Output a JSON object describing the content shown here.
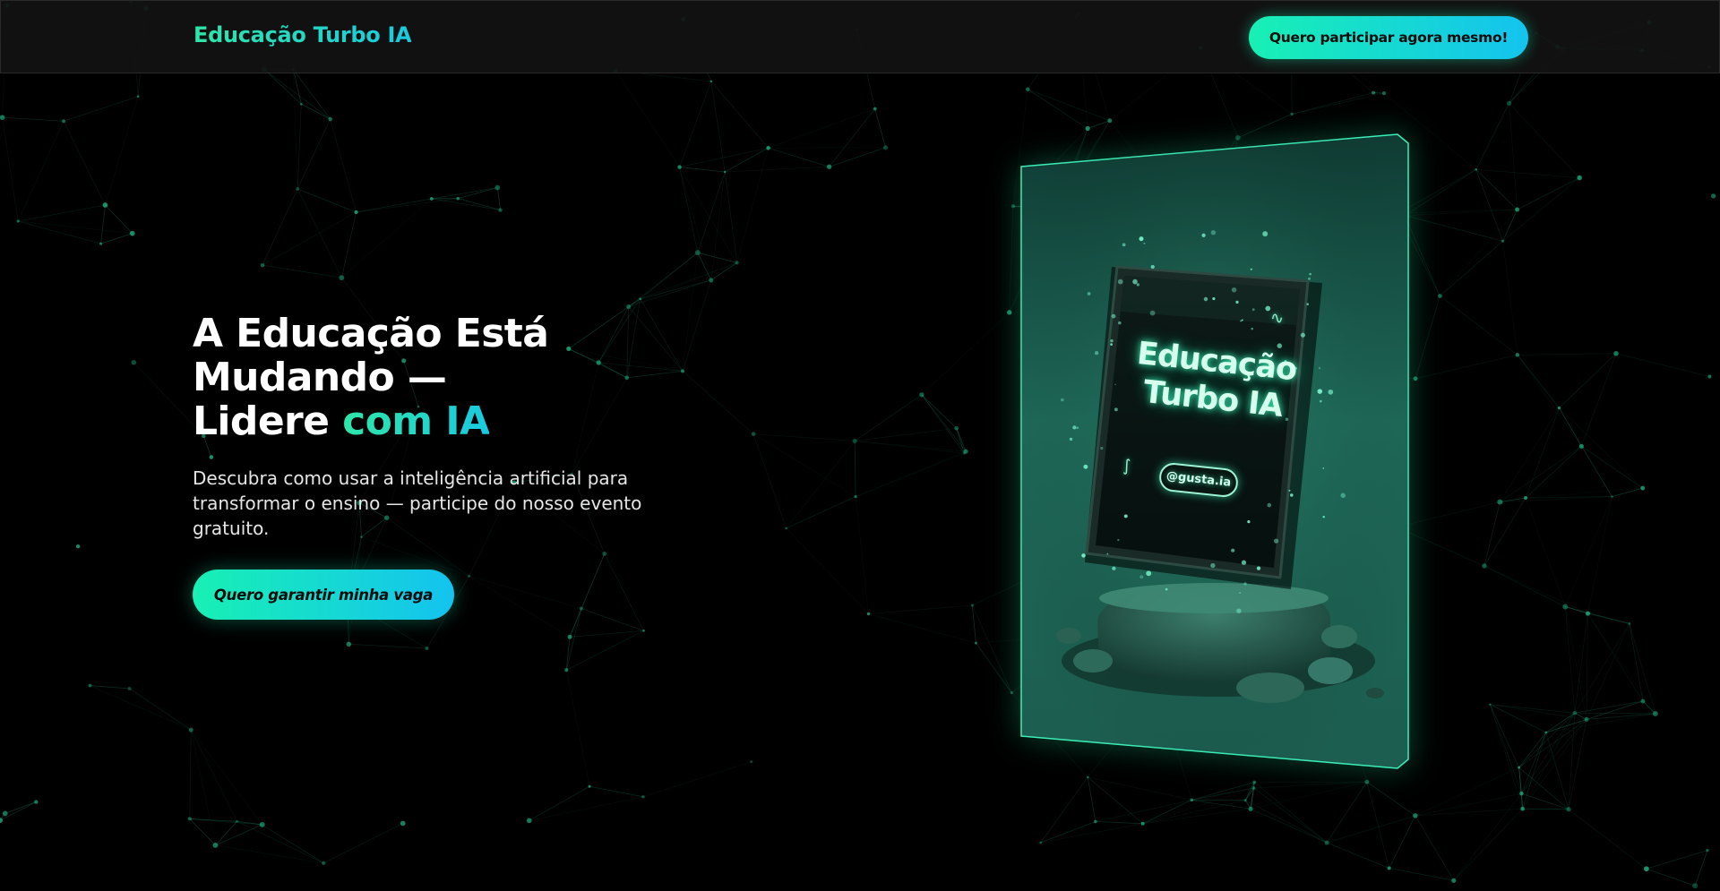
{
  "header": {
    "brand": "Educação Turbo IA",
    "cta_label": "Quero participar agora mesmo!"
  },
  "hero": {
    "title_line1": "A Educação Está",
    "title_line2": "Mudando —",
    "title_line3_plain": "Lidere ",
    "title_line3_accent": "com IA",
    "subtitle": "Descubra como usar a inteligência artificial para transformar o ensino — participe do nosso evento gratuito.",
    "cta_label": "Quero garantir minha vaga"
  },
  "poster": {
    "tablet_line1": "Educação",
    "tablet_line2": "Turbo IA",
    "handle": "@gusta.ia"
  },
  "colors": {
    "accent_green": "#18f0b4",
    "accent_cyan": "#14c3ef",
    "background": "#000000",
    "header_bg": "#121212",
    "network": "#1fb585"
  }
}
